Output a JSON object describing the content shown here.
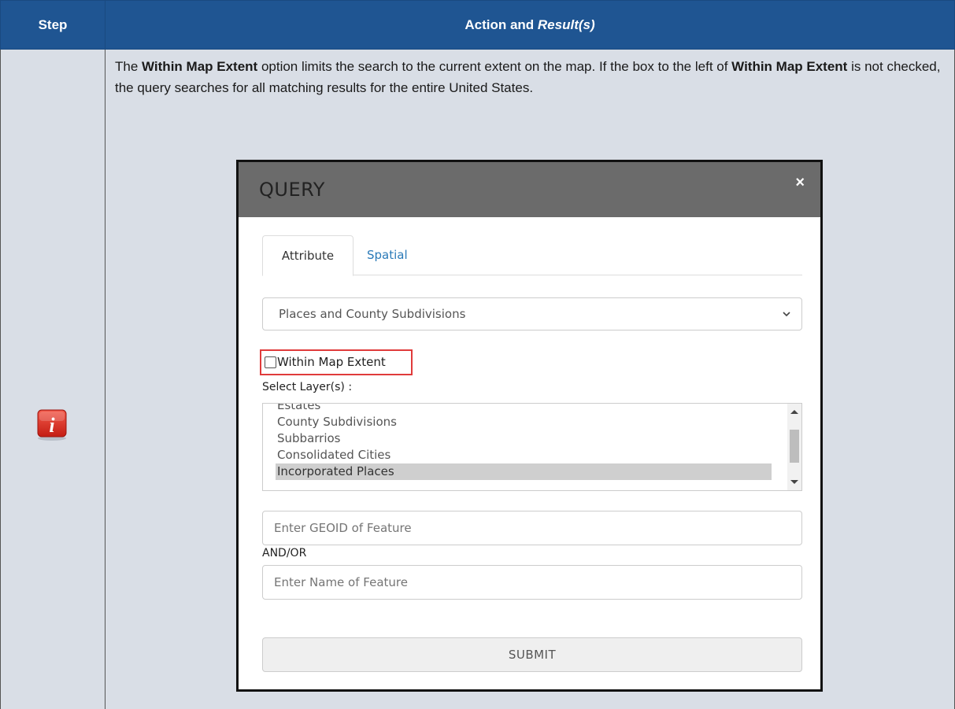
{
  "table": {
    "header_step": "Step",
    "header_action": "Action and ",
    "header_result": "Result(s)"
  },
  "description": {
    "part1": "The ",
    "bold1": "Within Map Extent",
    "part2": " option limits the search to the current extent on the map. If the box to the left of ",
    "bold2": "Within Map Extent",
    "part3": " is not checked, the query searches for all matching results for the entire United States."
  },
  "dialog": {
    "title": "QUERY",
    "close_label": "×",
    "tabs": [
      {
        "label": "Attribute",
        "active": true
      },
      {
        "label": "Spatial",
        "active": false
      }
    ],
    "dropdown_value": "Places and County Subdivisions",
    "within_extent_label": "Within Map Extent",
    "within_extent_checked": false,
    "layers_label": "Select Layer(s) :",
    "layers": [
      {
        "label": "Estates",
        "selected": false
      },
      {
        "label": "County Subdivisions",
        "selected": false
      },
      {
        "label": "Subbarrios",
        "selected": false
      },
      {
        "label": "Consolidated Cities",
        "selected": false
      },
      {
        "label": "Incorporated Places",
        "selected": true
      }
    ],
    "geoid_placeholder": "Enter GEOID of Feature",
    "and_or_label": "AND/OR",
    "name_placeholder": "Enter Name of Feature",
    "submit_label": "SUBMIT"
  },
  "colors": {
    "header_bg": "#1f5592",
    "row_bg": "#d9dee6",
    "highlight": "#e03b3b",
    "link": "#2a7ab8"
  },
  "icons": {
    "step_icon": "info-icon"
  }
}
